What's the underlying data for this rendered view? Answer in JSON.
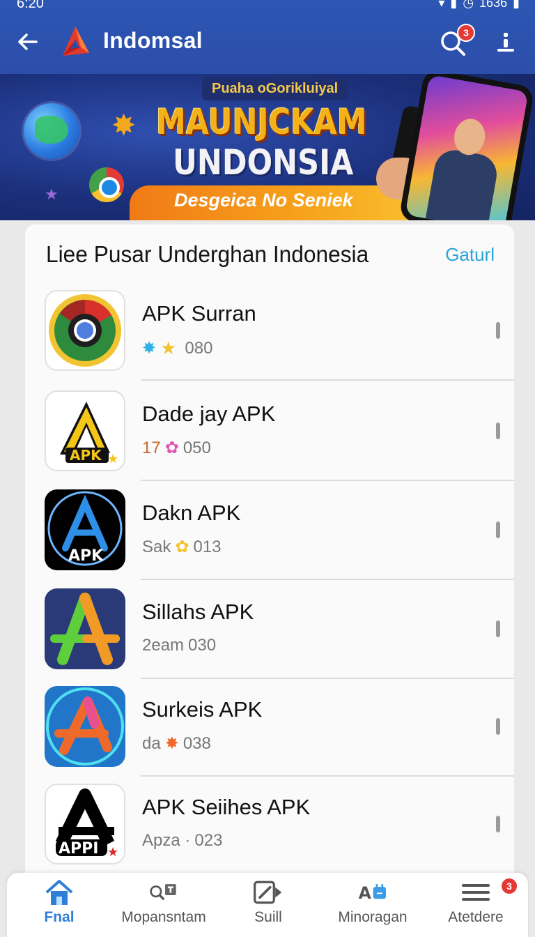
{
  "status_bar": {
    "time": "6:20",
    "battery": "1636"
  },
  "app_bar": {
    "title": "Indomsal",
    "search_badge": "3"
  },
  "banner": {
    "tag": "Puaha oGorikluiyal",
    "headline_1": "MAUNJCKAM",
    "headline_2": "UNDONSIA",
    "subtitle": "Desgeica No Seniek"
  },
  "section": {
    "title": "Liee Pusar Underghan Indonesia",
    "action": "Gaturl"
  },
  "apps": [
    {
      "name": "APK Surran",
      "meta_prefix": "",
      "meta_value": "080",
      "icon": "chrome-like-icon"
    },
    {
      "name": "Dade jay APK",
      "meta_prefix": "17",
      "meta_value": "050",
      "icon": "apk-yellow-icon"
    },
    {
      "name": "Dakn APK",
      "meta_prefix": "Sak",
      "meta_value": "013",
      "icon": "apk-blue-a-icon"
    },
    {
      "name": "Sillahs APK",
      "meta_prefix": "2eam",
      "meta_value": "030",
      "icon": "apk-green-orange-icon"
    },
    {
      "name": "Surkeis APK",
      "meta_prefix": "dа",
      "meta_value": "038",
      "icon": "apk-orange-a-icon"
    },
    {
      "name": "APK Seiihes APK",
      "meta_prefix": "Apza ·",
      "meta_value": "023",
      "icon": "apk-black-a-icon"
    }
  ],
  "bottom_nav": [
    {
      "label": "Fnal",
      "icon": "home-icon",
      "active": true
    },
    {
      "label": "Mopansntam",
      "icon": "search-icon"
    },
    {
      "label": "Suill",
      "icon": "edit-icon"
    },
    {
      "label": "Minoragan",
      "icon": "apps-icon"
    },
    {
      "label": "Atetdere",
      "icon": "menu-icon",
      "badge": "3"
    }
  ],
  "colors": {
    "app_bar": "#2d56b4",
    "accent": "#2aa4d8",
    "active_nav": "#2f7fd8",
    "badge": "#e53935"
  }
}
